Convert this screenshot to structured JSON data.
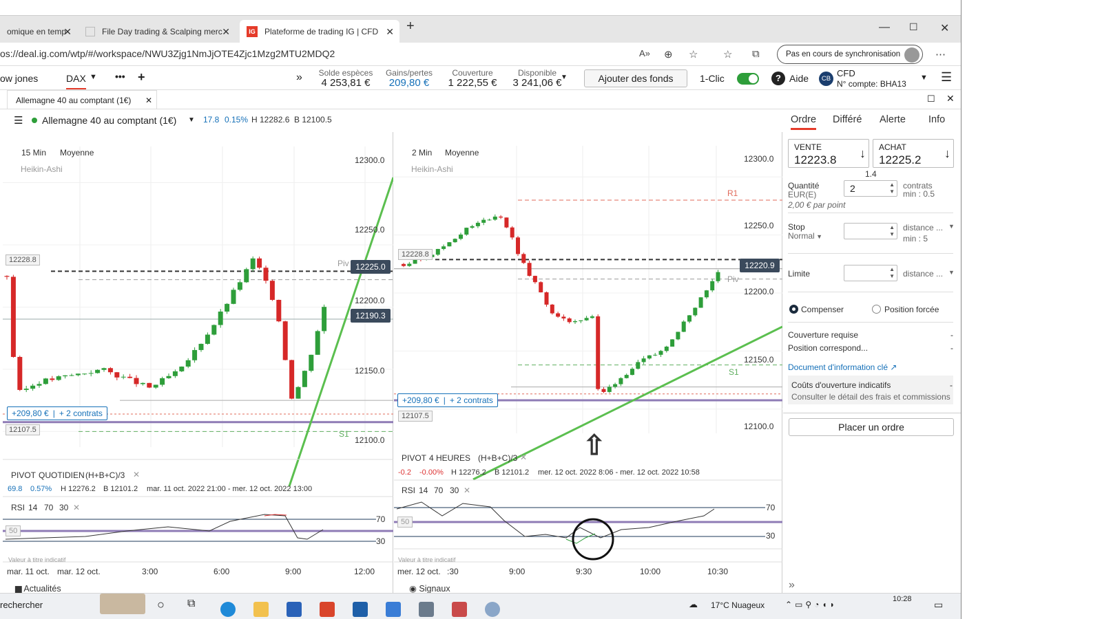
{
  "browser": {
    "tabs": [
      {
        "label": "omique en temp",
        "active": false
      },
      {
        "label": "File Day trading & Scalping merc",
        "active": false
      },
      {
        "label": "Plateforme de trading IG | CFD",
        "active": true
      }
    ],
    "url": "os://deal.ig.com/wtp/#/workspace/NWU3Zjg1NmJjOTE4Zjc1Mzg2MTU2MDQ2",
    "sync_label": "Pas en cours de synchronisation"
  },
  "header": {
    "markets": [
      "ow jones",
      "DAX"
    ],
    "metrics": [
      {
        "label": "Solde espèces",
        "value": "4 253,81 €"
      },
      {
        "label": "Gains/pertes",
        "value": "209,80 €"
      },
      {
        "label": "Couverture",
        "value": "1 222,55 €"
      },
      {
        "label": "Disponible",
        "value": "3 241,06 €"
      }
    ],
    "add_funds": "Ajouter des fonds",
    "one_click": "1-Clic",
    "help": "Aide",
    "account_badge": "CB",
    "account_type": "CFD",
    "account_number": "N° compte: BHA13"
  },
  "workspace": {
    "tab_label": "Allemagne 40 au comptant (1€)",
    "instrument": "Allemagne 40 au comptant (1€)",
    "change": "17.8",
    "change_pct": "0.15%",
    "high": "H 12282.6",
    "low": "B 12100.5"
  },
  "chart_data": [
    {
      "type": "candlestick",
      "interval": "15 Min",
      "average": "Moyenne",
      "style": "Heikin-Ashi",
      "y_ticks": [
        "12300.0",
        "12250.0",
        "12200.0",
        "12150.0",
        "12100.0"
      ],
      "ylim": [
        12093,
        12318
      ],
      "x_ticks": [
        "mar. 11 oct.",
        "mar. 12 oct.",
        "3:00",
        "6:00",
        "9:00",
        "12:00"
      ],
      "price_labels": {
        "sell": "12225.0",
        "buy": "12190.3",
        "level_a": "12228.8",
        "level_b": "12107.5"
      },
      "pivot_labels": {
        "piv": "Piv",
        "s1": "S1"
      },
      "position": {
        "pnl": "+209,80 €",
        "size": "+ 2 contrats"
      },
      "pivot_study": {
        "name": "PIVOT",
        "period": "QUOTIDIEN",
        "formula": "(H+B+C)/3",
        "change": "69.8",
        "change_pct": "0.57%",
        "high": "H 12276.2",
        "low": "B 12101.2",
        "range": "mar. 11 oct. 2022 21:00 - mer. 12 oct. 2022 13:00"
      },
      "rsi": {
        "label": "RSI",
        "params": [
          "14",
          "70",
          "30"
        ],
        "levels": [
          "70",
          "30"
        ],
        "mid": "50",
        "note": "Valeur à titre indicatif"
      },
      "footer": "Actualités"
    },
    {
      "type": "candlestick",
      "interval": "2 Min",
      "average": "Moyenne",
      "style": "Heikin-Ashi",
      "y_ticks": [
        "12300.0",
        "12250.0",
        "12200.0",
        "12150.0",
        "12100.0"
      ],
      "ylim": [
        12085,
        12315
      ],
      "x_ticks": [
        "mer. 12 oct.",
        ":30",
        "9:00",
        "9:30",
        "10:00",
        "10:30"
      ],
      "price_labels": {
        "sell": "12220.9",
        "level_a": "12228.8",
        "level_b": "12107.5"
      },
      "pivot_labels": {
        "r1": "R1",
        "piv": "Piv",
        "s1": "S1"
      },
      "position": {
        "pnl": "+209,80 €",
        "size": "+ 2 contrats"
      },
      "pivot_study": {
        "name": "PIVOT",
        "period": "4 HEURES",
        "formula": "(H+B+C)/3",
        "change": "-0.2",
        "change_pct": "-0.00%",
        "high": "H 12276.2",
        "low": "B 12101.2",
        "range": "mer. 12 oct. 2022 8:06 - mer. 12 oct. 2022 10:58"
      },
      "rsi": {
        "label": "RSI",
        "params": [
          "14",
          "70",
          "30"
        ],
        "levels": [
          "70",
          "30"
        ],
        "mid": "50",
        "note": "Valeur à titre indicatif"
      },
      "footer": "Signaux"
    }
  ],
  "order": {
    "tabs": [
      "Ordre",
      "Différé",
      "Alerte",
      "Info"
    ],
    "sell_label": "VENTE",
    "sell_price": "12223.8",
    "buy_label": "ACHAT",
    "buy_price": "12225.2",
    "spread": "1.4",
    "quantity_label": "Quantité",
    "quantity_unit": "EUR(E)",
    "quantity_value": "2",
    "contracts": "contrats",
    "contracts_min": "min : 0.5",
    "per_point": "2,00 € par point",
    "stop_label": "Stop",
    "stop_type": "Normal",
    "stop_distance": "distance ...",
    "stop_min": "min : 5",
    "limit_label": "Limite",
    "limit_distance": "distance ...",
    "radio_compensate": "Compenser",
    "radio_forced": "Position forcée",
    "margin_required": "Couverture requise",
    "position_corresp": "Position correspond...",
    "dash": "-",
    "doc_link": "Document d'information clé",
    "costs_title": "Coûts d'ouverture indicatifs",
    "costs_link": "Consulter le détail des frais et commissions",
    "place_order": "Placer un ordre"
  },
  "taskbar": {
    "search": "rechercher",
    "weather": "17°C  Nuageux",
    "time": "10:28"
  }
}
